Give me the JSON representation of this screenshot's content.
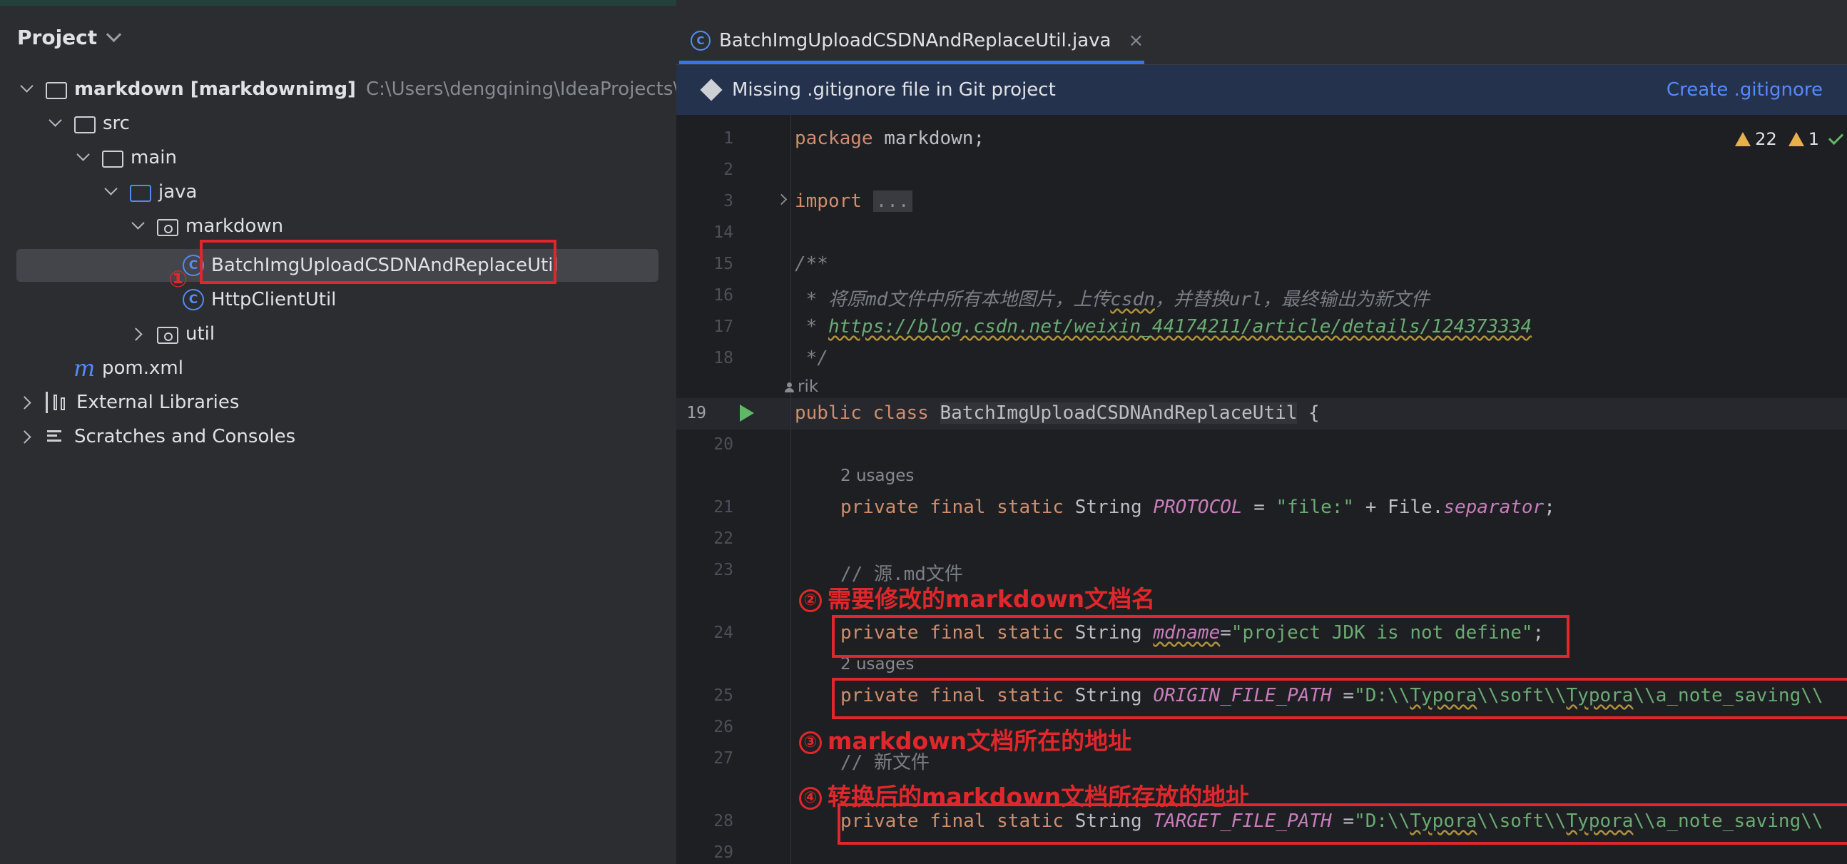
{
  "project_panel": {
    "title": "Project",
    "tree": [
      {
        "label": "markdown [markdownimg]",
        "path": "C:\\Users\\dengqining\\IdeaProjects\\mark"
      },
      {
        "label": "src"
      },
      {
        "label": "main"
      },
      {
        "label": "java"
      },
      {
        "label": "markdown"
      },
      {
        "label": "BatchImgUploadCSDNAndReplaceUtil"
      },
      {
        "label": "HttpClientUtil"
      },
      {
        "label": "util"
      },
      {
        "label": "pom.xml"
      },
      {
        "label": "External Libraries"
      },
      {
        "label": "Scratches and Consoles"
      }
    ],
    "annotation_1": "①"
  },
  "editor": {
    "tab_label": "BatchImgUploadCSDNAndReplaceUtil.java",
    "tab_close": "×",
    "banner_text": "Missing .gitignore file in Git project",
    "banner_link": "Create .gitignore",
    "warnings_count": "22",
    "weak_warnings_count": "1",
    "line_numbers": [
      "1",
      "2",
      "3",
      "14",
      "15",
      "16",
      "17",
      "18",
      "19",
      "20",
      "21",
      "22",
      "23",
      "24",
      "25",
      "26",
      "27",
      "28",
      "29"
    ],
    "author_hint": "rik",
    "usages_hint": "2 usages",
    "code": {
      "l1_kw": "package",
      "l1_rest": " markdown;",
      "l3_kw": "import",
      "l3_fold": "...",
      "l15": "/**",
      "l16_a": " * 将原md文件中所有本地图片，上传",
      "l16_b": "csdn",
      "l16_c": "，并替换url，最终输出为新文件",
      "l17_a": " * ",
      "l17_link": "https://blog.csdn.net/weixin_44174211/article/details/124373334",
      "l18": " */",
      "l19_kw": "public class",
      "l19_cls": "BatchImgUploadCSDNAndReplaceUtil",
      "l19_rest": " {",
      "l21_kw": "private final static",
      "l21_type": " String ",
      "l21_fld": "PROTOCOL",
      "l21_eq": " = ",
      "l21_str": "\"file:\"",
      "l21_plus": " + File.",
      "l21_fld2": "separator",
      "l21_end": ";",
      "l23": "// 源.md文件",
      "l24_kw": "private final static",
      "l24_type": " String ",
      "l24_fld": "mdname",
      "l24_eq": "=",
      "l24_str": "\"project JDK is not define\"",
      "l24_end": ";",
      "l25_kw": "private final static",
      "l25_type": " String ",
      "l25_fld": "ORIGIN_FILE_PATH",
      "l25_eq": " =",
      "l25_str_a": "\"D:\\\\",
      "l25_str_b": "Typora",
      "l25_str_c": "\\\\soft\\\\",
      "l25_str_d": "Typora",
      "l25_str_e": "\\\\a_note_saving\\\\",
      "l27": "// 新文件",
      "l28_kw": "private final static",
      "l28_type": " String ",
      "l28_fld": "TARGET_FILE_PATH",
      "l28_eq": " =",
      "l28_str_a": "\"D:\\\\",
      "l28_str_b": "Typora",
      "l28_str_c": "\\\\soft\\\\",
      "l28_str_d": "Typora",
      "l28_str_e": "\\\\a_note_saving\\\\"
    },
    "annotations": {
      "a2_num": "②",
      "a2_text": "需要修改的markdown文档名",
      "a3_num": "③",
      "a3_text": "markdown文档所在的地址",
      "a4_num": "④",
      "a4_text": "转换后的markdown文档所存放的地址"
    }
  }
}
